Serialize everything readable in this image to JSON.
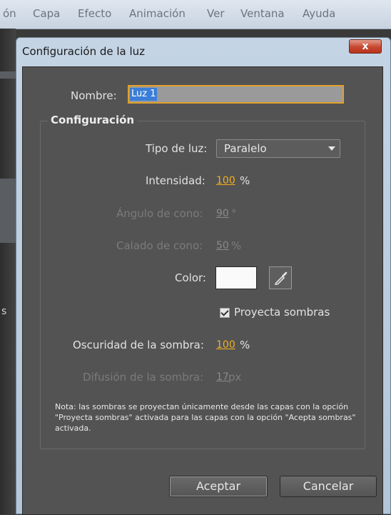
{
  "menubar": {
    "items": [
      "ón",
      "Capa",
      "Efecto",
      "Animación",
      "Ver",
      "Ventana",
      "Ayuda"
    ]
  },
  "background": {
    "side_text": "s"
  },
  "dialog": {
    "title": "Configuración de la luz",
    "close_label": "x",
    "name_label": "Nombre:",
    "name_value": "Luz 1",
    "group_title": "Configuración",
    "fields": {
      "tipo_label": "Tipo de luz:",
      "tipo_value": "Paralelo",
      "intensidad_label": "Intensidad:",
      "intensidad_value": "100",
      "intensidad_unit": "%",
      "angulo_label": "Ángulo de cono:",
      "angulo_value": "90",
      "angulo_unit": "°",
      "calado_label": "Calado de cono:",
      "calado_value": "50",
      "calado_unit": "%",
      "color_label": "Color:",
      "color_value": "#fafafa",
      "proyecta_label": "Proyecta sombras",
      "proyecta_checked": true,
      "oscuridad_label": "Oscuridad de la sombra:",
      "oscuridad_value": "100",
      "oscuridad_unit": "%",
      "difusion_label": "Difusión de la sombra:",
      "difusion_value": "17",
      "difusion_unit": "px"
    },
    "note": "Nota: las sombras se proyectan únicamente desde las capas con la opción \"Proyecta sombras\" activada para las capas con la opción \"Acepta sombras\" activada.",
    "buttons": {
      "ok": "Aceptar",
      "cancel": "Cancelar"
    }
  },
  "colors": {
    "accent_orange": "#f0b020",
    "selection_blue": "#3a7ed8",
    "panel_gray": "#535353"
  }
}
